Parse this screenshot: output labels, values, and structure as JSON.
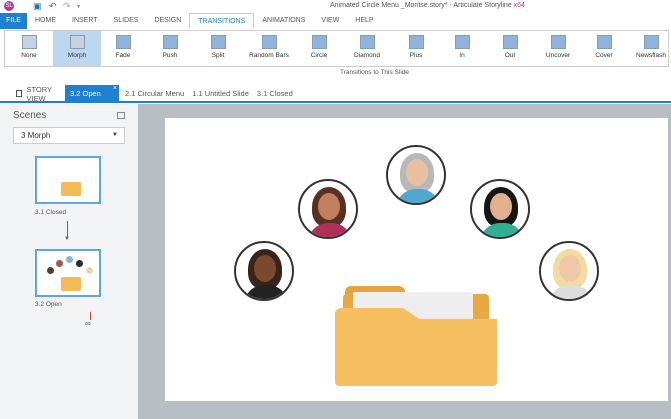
{
  "window": {
    "title": "Animated Circle Menu _Montse.story* - Articulate Storyline",
    "arch": "x64",
    "logo": "SL"
  },
  "menu_tabs": [
    "FILE",
    "HOME",
    "INSERT",
    "SLIDES",
    "DESIGN",
    "TRANSITIONS",
    "ANIMATIONS",
    "VIEW",
    "HELP"
  ],
  "transitions": [
    "None",
    "Morph",
    "Fade",
    "Push",
    "Split",
    "Random Bars",
    "Circle",
    "Diamond",
    "Plus",
    "In",
    "Out",
    "Uncover",
    "Cover",
    "Newsflash"
  ],
  "ribbon_group_label": "Transitions to This Slide",
  "doc_tabs": {
    "story_view": "STORY VIEW",
    "active": "3.2 Open",
    "others": [
      "2.1 Circular Menu",
      "1.1 Untitled Slide",
      "3.1 Closed"
    ],
    "close": "×"
  },
  "scenes": {
    "title": "Scenes",
    "selected": "3 Morph",
    "slides": [
      "3.1 Closed",
      "3.2 Open"
    ]
  },
  "colors": {
    "accent": "#1f7fd1",
    "folder": "#f5b955"
  }
}
